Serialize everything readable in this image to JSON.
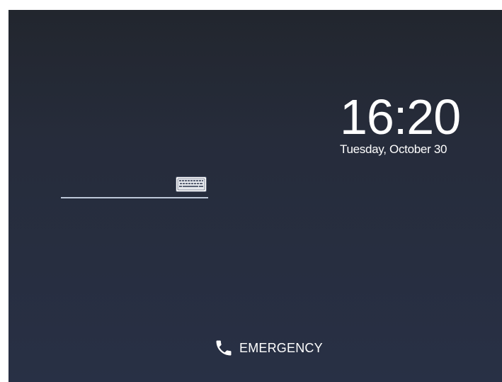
{
  "lockscreen": {
    "time": "16:20",
    "date": "Tuesday, October 30",
    "password": {
      "value": "",
      "placeholder": ""
    },
    "keyboard_icon": "keyboard-icon",
    "emergency": {
      "label": "EMERGENCY",
      "icon": "phone-icon"
    }
  },
  "colors": {
    "background_top": "#22262e",
    "background_bottom": "#283045",
    "text": "#ffffff",
    "input_underline": "#bcc7d8"
  }
}
